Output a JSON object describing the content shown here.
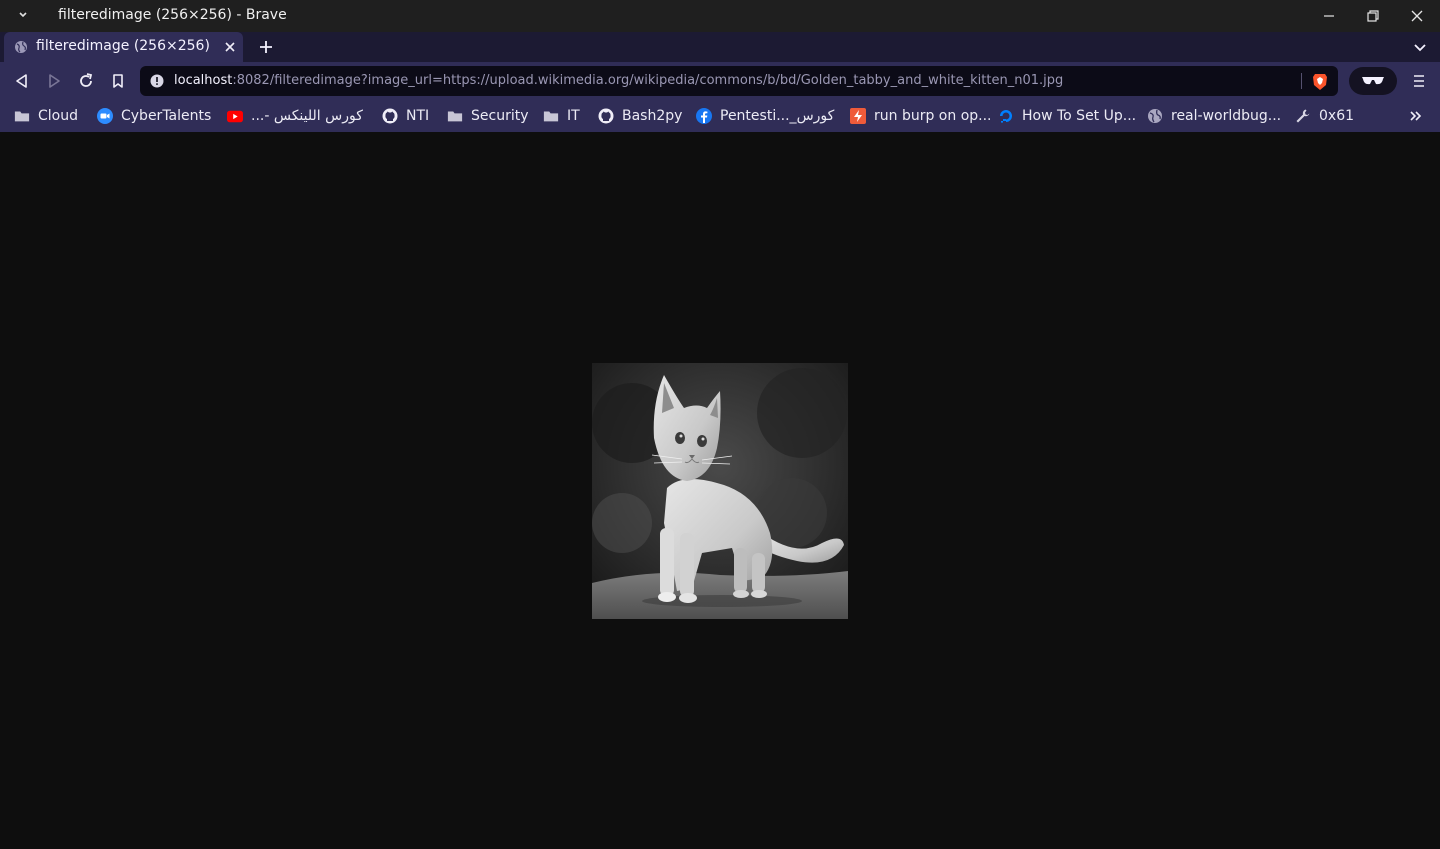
{
  "window": {
    "title": "filteredimage (256×256) - Brave"
  },
  "tab": {
    "title": "filteredimage (256×256)"
  },
  "address_bar": {
    "host": "localhost",
    "path": ":8082/filteredimage?image_url=https://upload.wikimedia.org/wikipedia/commons/b/bd/Golden_tabby_and_white_kitten_n01.jpg"
  },
  "bookmarks": [
    {
      "label": "Cloud",
      "icon": "folder-icon"
    },
    {
      "label": "CyberTalents",
      "icon": "zoom-icon"
    },
    {
      "label": "كورس اللينكس -...",
      "icon": "youtube-icon"
    },
    {
      "label": "NTI",
      "icon": "github-icon"
    },
    {
      "label": "Security",
      "icon": "folder-icon"
    },
    {
      "label": "IT",
      "icon": "folder-icon"
    },
    {
      "label": "Bash2py",
      "icon": "github-icon"
    },
    {
      "label": "Pentesti..._كورس",
      "icon": "facebook-icon"
    },
    {
      "label": "run burp on op...",
      "icon": "zap-icon"
    },
    {
      "label": "How To Set Up...",
      "icon": "digitalocean-icon"
    },
    {
      "label": "real-worldbug...",
      "icon": "globe-icon"
    },
    {
      "label": "0x61",
      "icon": "wrench-icon"
    }
  ],
  "content": {
    "image_description_alt": "",
    "image_filter": "grayscale"
  },
  "colors": {
    "titlebar": "#1f1f1f",
    "tabstrip": "#1c1a33",
    "toolbar": "#302d57",
    "urlbar": "#0c0b17",
    "page_bg": "#0e0e0e",
    "brave_orange": "#fb542b"
  }
}
